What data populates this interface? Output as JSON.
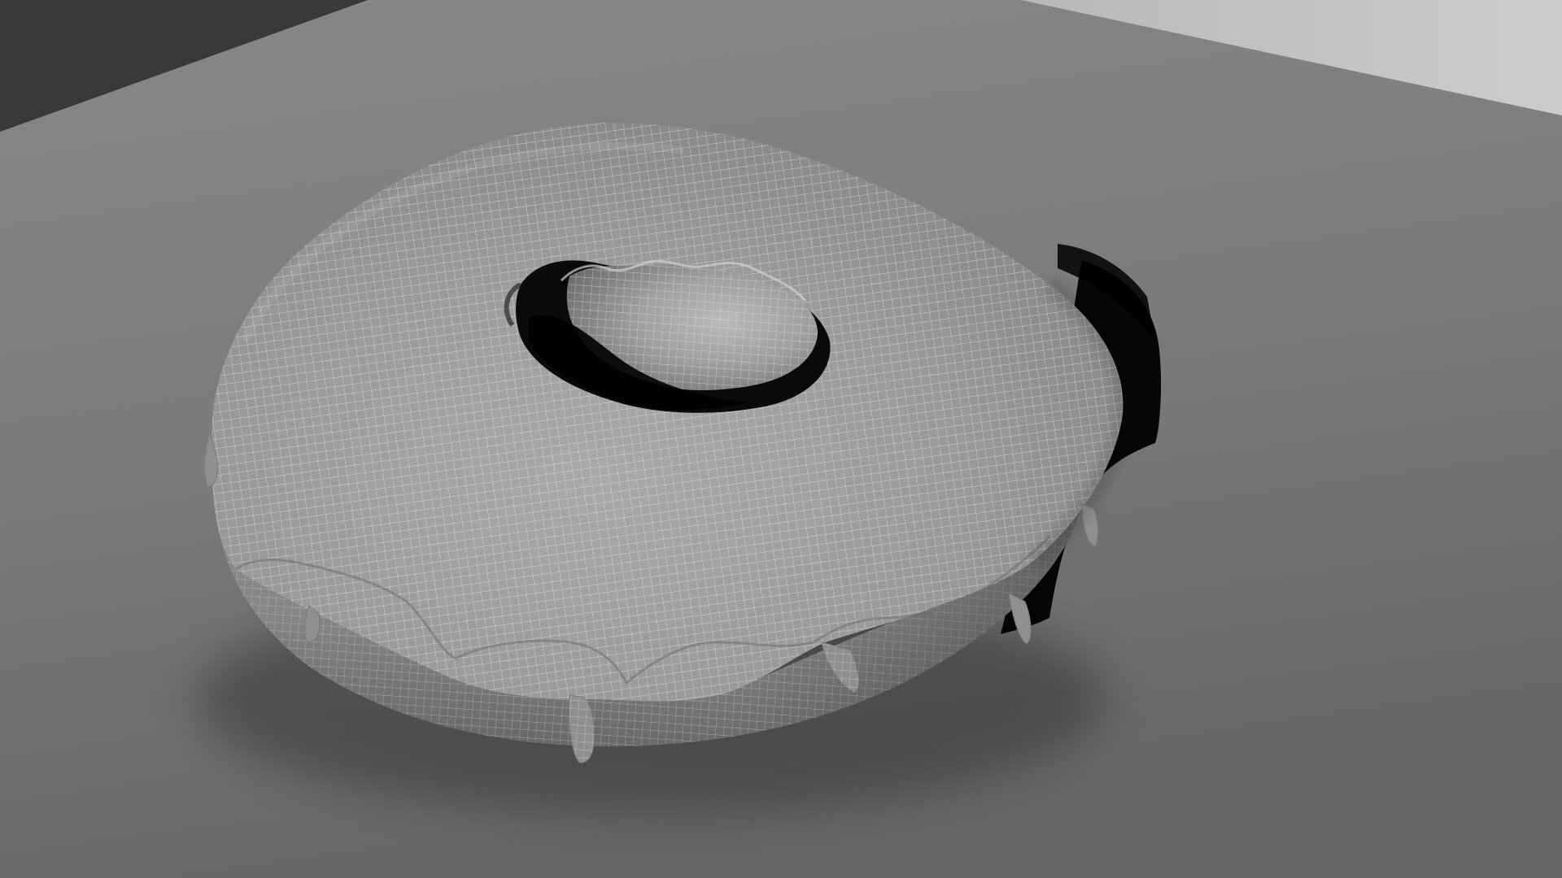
{
  "scene": {
    "subject": "glazed-donut-wireframe-render",
    "colors": {
      "floor_light": "#8c8c8c",
      "floor_dark": "#6f6f6f",
      "wall_left": "#404040",
      "wall_right": "#d2d2d2",
      "donut_light": "#a4a4a4",
      "donut_mid": "#8a8a8a",
      "donut_dark": "#5a5a5a",
      "shadow": "#000000",
      "wire": "#e6e6e6"
    }
  }
}
